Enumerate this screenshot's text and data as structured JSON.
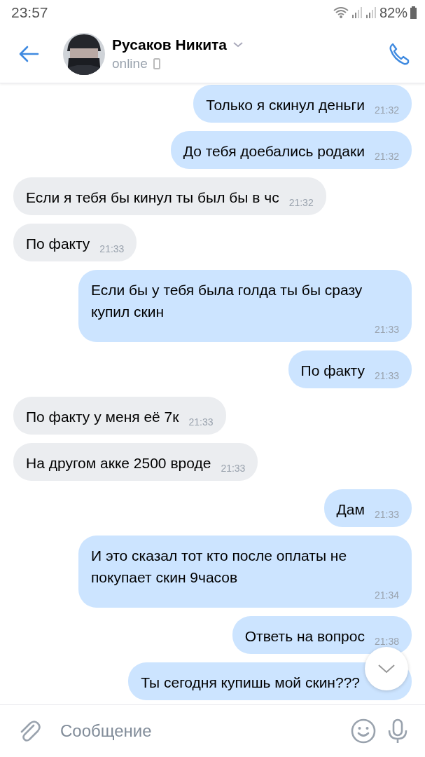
{
  "status_bar": {
    "time": "23:57",
    "battery": "82%"
  },
  "header": {
    "name": "Русаков Никита",
    "status": "online"
  },
  "messages": [
    {
      "kind": "outgoing",
      "text": "Только я скинул деньги",
      "time": "21:32"
    },
    {
      "kind": "outgoing",
      "text": "До тебя доебались родаки",
      "time": "21:32"
    },
    {
      "kind": "incoming",
      "text": "Если я тебя бы кинул ты был бы в чс",
      "time": "21:32"
    },
    {
      "kind": "incoming",
      "text": "По факту",
      "time": "21:33"
    },
    {
      "kind": "outgoing",
      "text": "Если бы у тебя была голда ты бы сразу купил скин",
      "time": "21:33"
    },
    {
      "kind": "outgoing",
      "text": "По факту",
      "time": "21:33"
    },
    {
      "kind": "incoming",
      "text": "По факту у меня её 7к",
      "time": "21:33"
    },
    {
      "kind": "incoming",
      "text": "На другом акке 2500 вроде",
      "time": "21:33"
    },
    {
      "kind": "outgoing",
      "text": "Дам",
      "time": "21:33"
    },
    {
      "kind": "outgoing",
      "text": "И это сказал тот кто после оплаты не покупает скин 9часов",
      "time": "21:34"
    },
    {
      "kind": "outgoing",
      "text": "Ответь на вопрос",
      "time": "21:38"
    },
    {
      "kind": "outgoing",
      "text": "Ты сегодня купишь мой скин???"
    }
  ],
  "composer": {
    "placeholder": "Сообщение"
  }
}
